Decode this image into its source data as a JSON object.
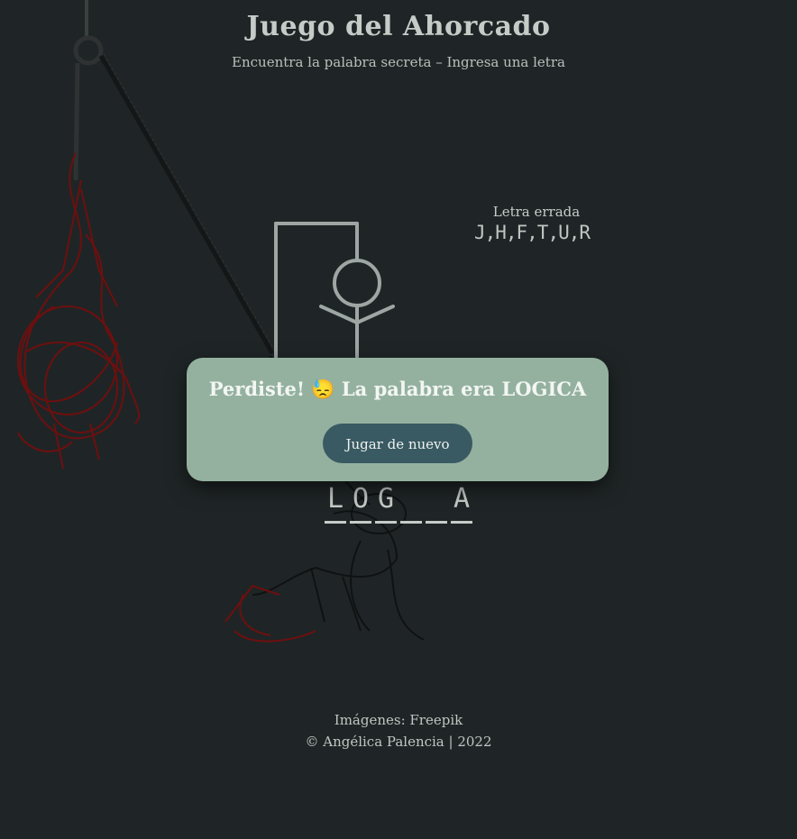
{
  "header": {
    "title": "Juego del Ahorcado",
    "subtitle": "Encuentra la palabra secreta – Ingresa una letra"
  },
  "wrong": {
    "label": "Letra errada",
    "letters": "J,H,F,T,U,R"
  },
  "word": {
    "slots": [
      "L",
      "O",
      "G",
      "",
      "",
      "A"
    ]
  },
  "modal": {
    "message": "Perdiste! 😓 La palabra era LOGICA",
    "button": "Jugar de nuevo"
  },
  "footer": {
    "credits": "Imágenes: Freepik",
    "copyright": "© Angélica Palencia | 2022"
  },
  "colors": {
    "background": "#1f2526",
    "modal": "#94b19f",
    "button": "#395a63",
    "illustration_red": "#6e0f0f"
  }
}
